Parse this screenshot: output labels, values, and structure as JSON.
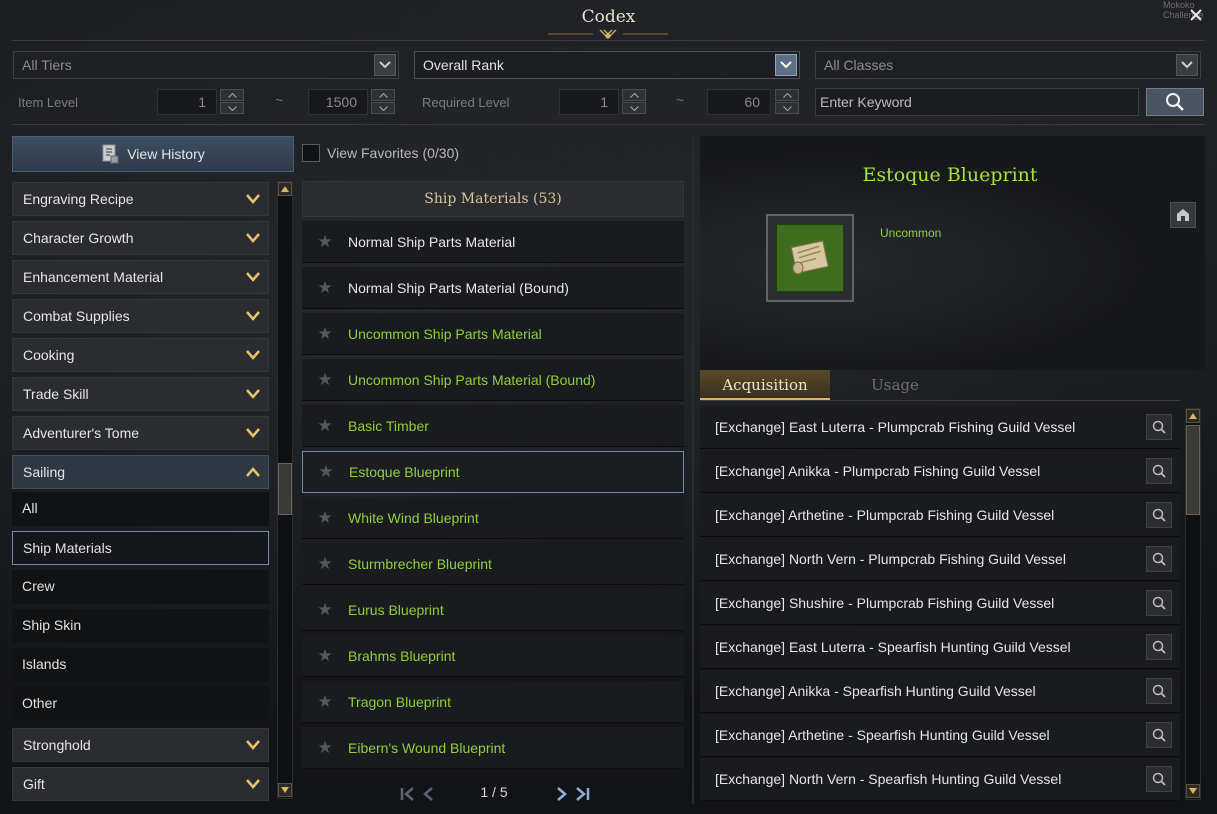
{
  "window": {
    "title": "Codex",
    "corner_text": "Mokoko\nChallenge"
  },
  "filters": {
    "tier": "All Tiers",
    "rank": "Overall Rank",
    "classes": "All Classes",
    "item_level_label": "Item Level",
    "item_level_min": "1",
    "item_level_max": "1500",
    "required_level_label": "Required Level",
    "required_level_min": "1",
    "required_level_max": "60",
    "tilde": "~",
    "keyword_placeholder": "Enter Keyword"
  },
  "left": {
    "view_history": "View History",
    "categories_top": [
      "Engraving Recipe",
      "Character Growth",
      "Enhancement Material",
      "Combat Supplies",
      "Cooking",
      "Trade Skill",
      "Adventurer's Tome"
    ],
    "open_category": "Sailing",
    "subcategories": [
      "All",
      "Ship Materials",
      "Crew",
      "Ship Skin",
      "Islands",
      "Other"
    ],
    "selected_subcategory": "Ship Materials",
    "categories_bottom": [
      "Stronghold",
      "Gift"
    ]
  },
  "middle": {
    "favorites_label": "View Favorites (0/30)",
    "list_header": "Ship Materials (53)",
    "items": [
      {
        "name": "Normal Ship Parts Material",
        "color": "#e6e6e6"
      },
      {
        "name": "Normal Ship Parts Material (Bound)",
        "color": "#e6e6e6"
      },
      {
        "name": "Uncommon Ship Parts Material",
        "color": "#8fd13a"
      },
      {
        "name": "Uncommon Ship Parts Material (Bound)",
        "color": "#8fd13a"
      },
      {
        "name": "Basic Timber",
        "color": "#8fd13a"
      },
      {
        "name": "Estoque Blueprint",
        "color": "#8fd13a"
      },
      {
        "name": "White Wind Blueprint",
        "color": "#8fd13a"
      },
      {
        "name": "Sturmbrecher Blueprint",
        "color": "#8fd13a"
      },
      {
        "name": "Eurus Blueprint",
        "color": "#8fd13a"
      },
      {
        "name": "Brahms Blueprint",
        "color": "#8fd13a"
      },
      {
        "name": "Tragon Blueprint",
        "color": "#8fd13a"
      },
      {
        "name": "Eibern's Wound Blueprint",
        "color": "#8fd13a"
      }
    ],
    "selected_item": "Estoque Blueprint",
    "page": "1 / 5"
  },
  "detail": {
    "item_name": "Estoque Blueprint",
    "grade": "Uncommon",
    "tabs": {
      "acquisition": "Acquisition",
      "usage": "Usage"
    },
    "acquisition": [
      "[Exchange] East Luterra - Plumpcrab Fishing Guild Vessel",
      "[Exchange] Anikka - Plumpcrab Fishing Guild Vessel",
      "[Exchange] Arthetine - Plumpcrab Fishing Guild Vessel",
      "[Exchange] North Vern - Plumpcrab Fishing Guild Vessel",
      "[Exchange] Shushire - Plumpcrab Fishing Guild Vessel",
      "[Exchange] East Luterra - Spearfish Hunting Guild Vessel",
      "[Exchange] Anikka - Spearfish Hunting Guild Vessel",
      "[Exchange] Arthetine - Spearfish Hunting Guild Vessel",
      "[Exchange] North Vern - Spearfish Hunting Guild Vessel"
    ]
  }
}
